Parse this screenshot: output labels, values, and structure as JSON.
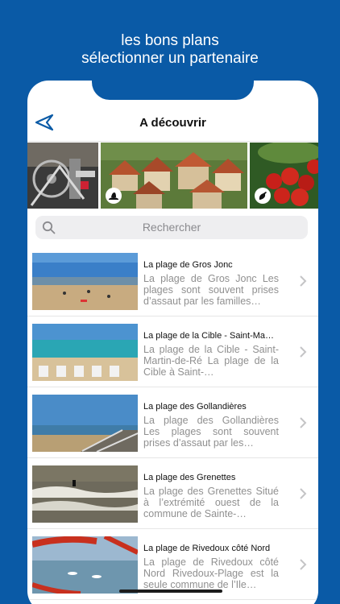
{
  "promo": {
    "line1": "les bons plans",
    "line2": "sélectionner un partenaire"
  },
  "navbar": {
    "title": "A découvrir",
    "back_icon": "back-arrow-icon"
  },
  "gallery": {
    "tiles": [
      {
        "name": "bike-mechanics-photo"
      },
      {
        "name": "village-rooftops-photo",
        "badge_icon": "hat-icon"
      },
      {
        "name": "tomatoes-photo",
        "badge_icon": "pepper-icon"
      }
    ]
  },
  "search": {
    "placeholder": "Rechercher"
  },
  "items": [
    {
      "title": "La plage de Gros Jonc",
      "description": "La plage de Gros Jonc Les plages sont souvent prises d’assaut par les familles…"
    },
    {
      "title": "La plage de la Cible - Saint-Ma…",
      "description": "La plage de la Cible - Saint-Martin-de-Ré La plage de la Cible à Saint-…"
    },
    {
      "title": "La plage des Gollandières",
      "description": "La plage des Gollandières Les plages sont souvent prises d’assaut par les…"
    },
    {
      "title": "La plage des Grenettes",
      "description": "La plage des Grenettes Situé à l’extrémité ouest de la commune de Sainte-…"
    },
    {
      "title": "La plage de Rivedoux côté Nord",
      "description": "La plage de Rivedoux côté Nord Rivedoux-Plage est la seule commune de l’Ile…"
    }
  ],
  "colors": {
    "background": "#0a5aa6",
    "back_icon": "#0a5aa6"
  }
}
